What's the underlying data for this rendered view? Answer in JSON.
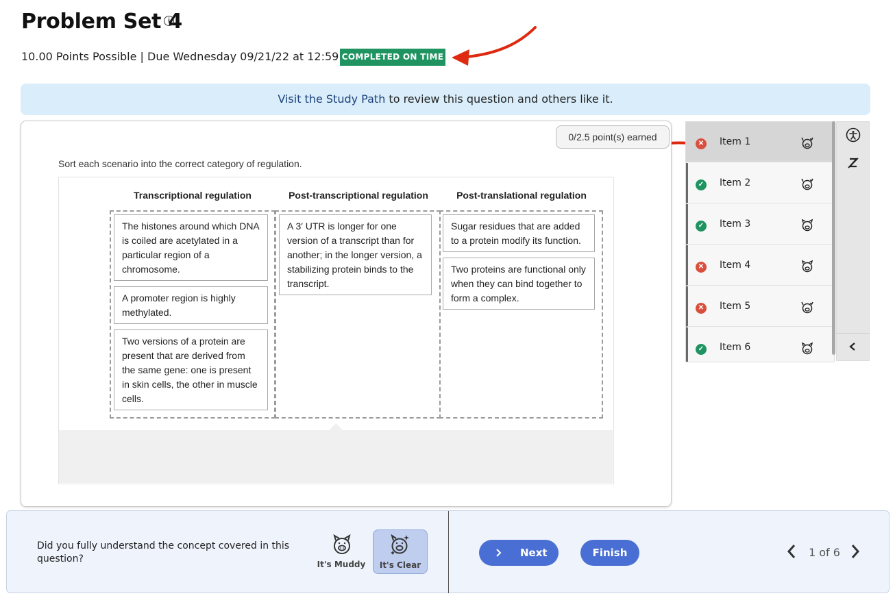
{
  "header": {
    "title": "Problem Set 4",
    "info_icon": "i",
    "meta": "10.00 Points Possible | Due Wednesday 09/21/22 at 12:59 AM",
    "status_badge": "COMPLETED ON TIME",
    "badge_color": "#1f9461"
  },
  "banner": {
    "link_text": "Visit the Study Path",
    "rest_text": " to review this question and others like it."
  },
  "question": {
    "points_earned": "0/2.5 point(s) earned",
    "instruction": "Sort each scenario into the correct category of regulation.",
    "columns": [
      {
        "heading": "Transcriptional regulation",
        "chips": [
          "The histones around which DNA is coiled are acetylated in a particular region of a chromosome.",
          "A promoter region is highly methylated.",
          "Two versions of a protein are present that are derived from the same gene: one is present in skin cells, the other in muscle cells."
        ]
      },
      {
        "heading": "Post-transcriptional regulation",
        "chips": [
          " A 3′ UTR is longer for one version of a transcript than for another; in the longer version, a stabilizing protein binds to the transcript."
        ]
      },
      {
        "heading": "Post-translational regulation",
        "chips": [
          "Sugar residues that are added to a protein modify its function.",
          "Two proteins are functional only when they can bind together to form a complex."
        ]
      }
    ]
  },
  "sidebar": {
    "items": [
      {
        "label": "Item 1",
        "status": "incorrect",
        "active": true
      },
      {
        "label": "Item 2",
        "status": "correct"
      },
      {
        "label": "Item 3",
        "status": "correct"
      },
      {
        "label": "Item 4",
        "status": "incorrect"
      },
      {
        "label": "Item 5",
        "status": "incorrect"
      },
      {
        "label": "Item 6",
        "status": "correct"
      }
    ],
    "tools": [
      "accessibility-icon",
      "no-zoom-icon",
      "chevron-left-icon"
    ]
  },
  "footer": {
    "prompt": "Did you fully understand the concept covered in this question?",
    "muddy_label": "It's Muddy",
    "clear_label": "It's Clear",
    "next_label": "Next",
    "finish_label": "Finish",
    "pager": "1 of 6"
  },
  "colors": {
    "accent": "#4a6fd4",
    "banner": "#d9edfa",
    "incorrect": "#d94f3d",
    "correct": "#1f9461",
    "annotation_arrow": "#dd2a10"
  }
}
